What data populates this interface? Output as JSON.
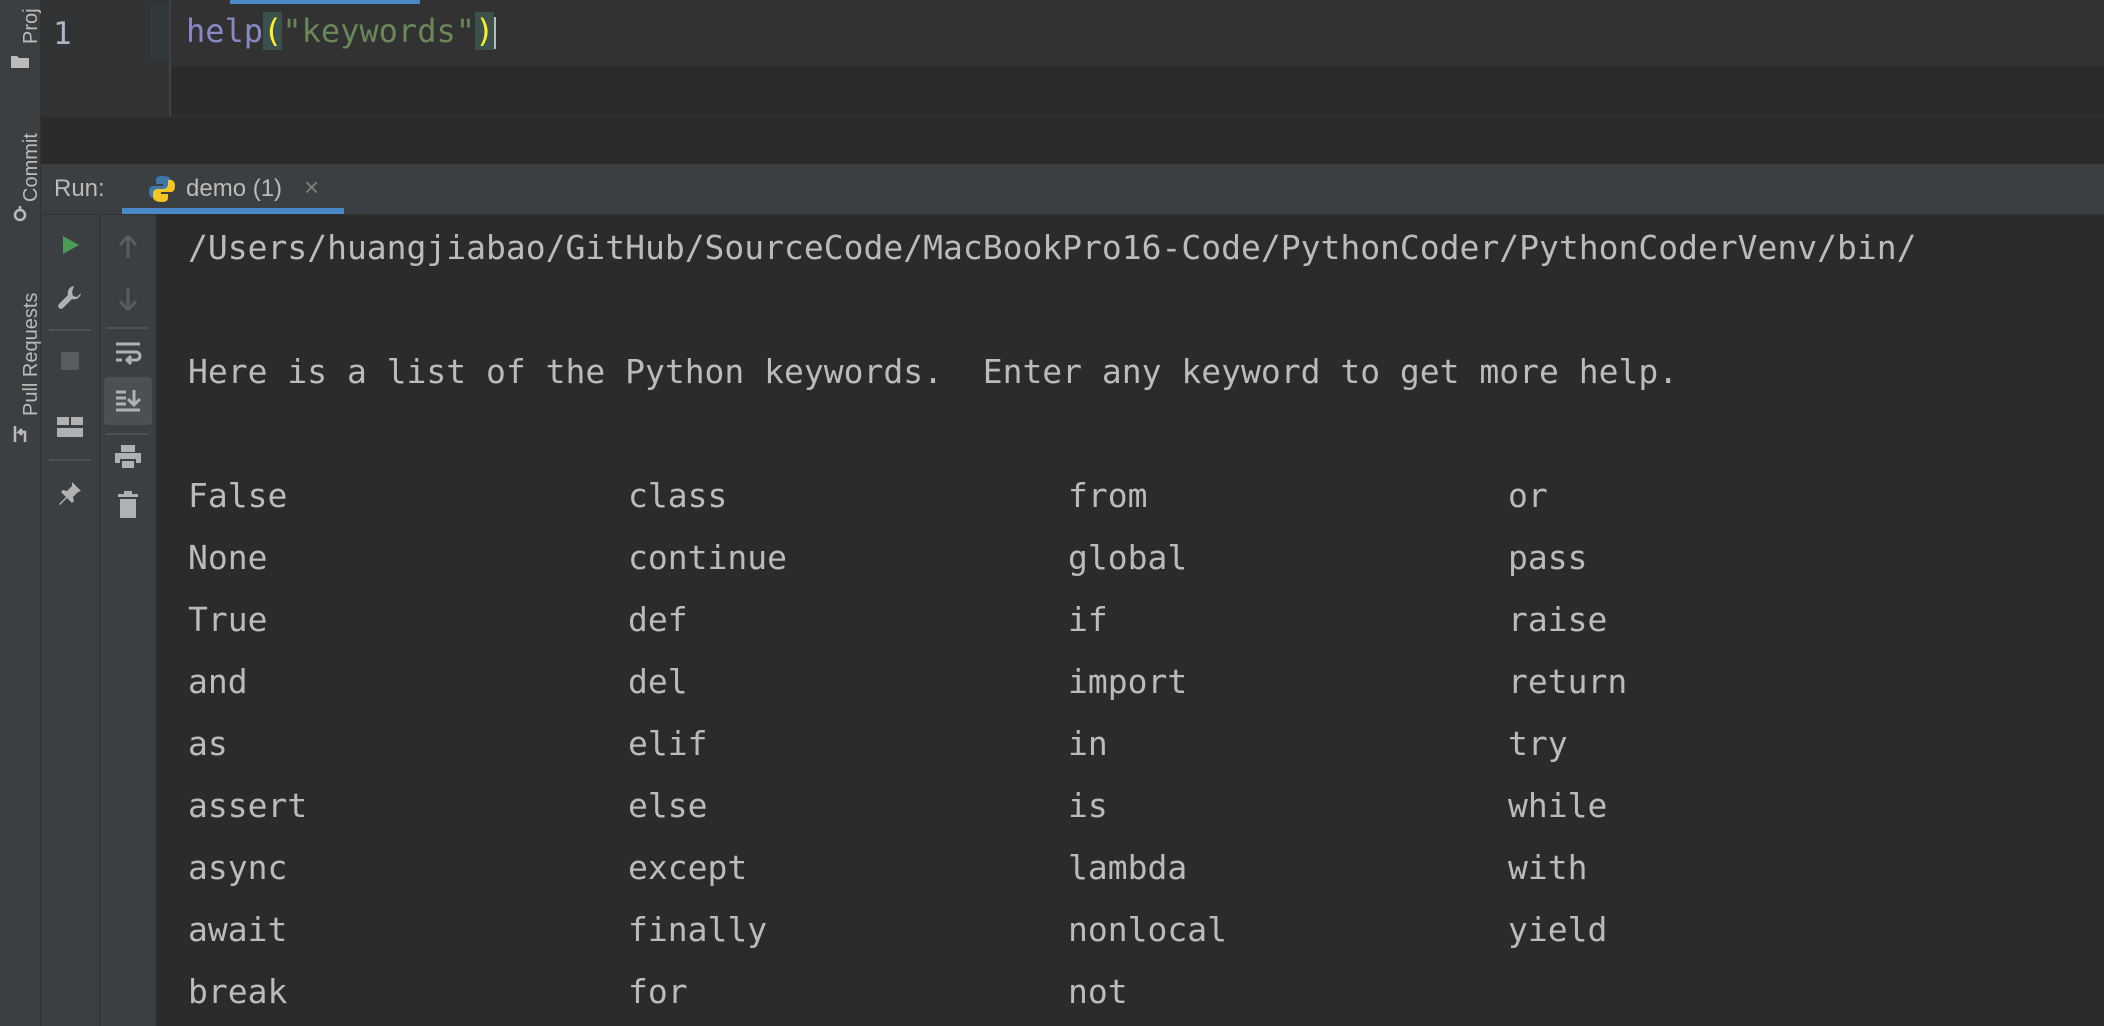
{
  "side_tabs": [
    {
      "label": "Proj",
      "icon": "folder-icon"
    },
    {
      "label": "Commit",
      "icon": "commit-icon"
    },
    {
      "label": "Pull Requests",
      "icon": "pull-request-icon"
    }
  ],
  "editor": {
    "line_number": "1",
    "code": {
      "func": "help",
      "open_paren": "(",
      "string": "\"keywords\"",
      "close_paren": ")"
    }
  },
  "run_panel": {
    "label": "Run:",
    "tab_label": "demo (1)",
    "tab_icon": "python-icon",
    "close_glyph": "×"
  },
  "toolbar_left": [
    "run-icon",
    "wrench-icon",
    "stop-icon",
    "layout-icon",
    "pin-icon"
  ],
  "toolbar_right": [
    "up-arrow-icon",
    "down-arrow-icon",
    "soft-wrap-icon",
    "scroll-to-end-icon",
    "print-icon",
    "trash-icon"
  ],
  "console": {
    "path_line": "/Users/huangjiabao/GitHub/SourceCode/MacBookPro16-Code/PythonCoder/PythonCoderVenv/bin/",
    "intro_line": "Here is a list of the Python keywords.  Enter any keyword to get more help.",
    "keywords_columns": [
      [
        "False",
        "None",
        "True",
        "and",
        "as",
        "assert",
        "async",
        "await",
        "break"
      ],
      [
        "class",
        "continue",
        "def",
        "del",
        "elif",
        "else",
        "except",
        "finally",
        "for"
      ],
      [
        "from",
        "global",
        "if",
        "import",
        "in",
        "is",
        "lambda",
        "nonlocal",
        "not"
      ],
      [
        "or",
        "pass",
        "raise",
        "return",
        "try",
        "while",
        "with",
        "yield"
      ]
    ]
  },
  "colors": {
    "background": "#2b2b2b",
    "panel": "#3c3f41",
    "accent": "#4a88c7",
    "run_green": "#499c54",
    "builtin": "#8888c6",
    "string": "#6a8759",
    "paren_highlight": "#ffef28"
  }
}
